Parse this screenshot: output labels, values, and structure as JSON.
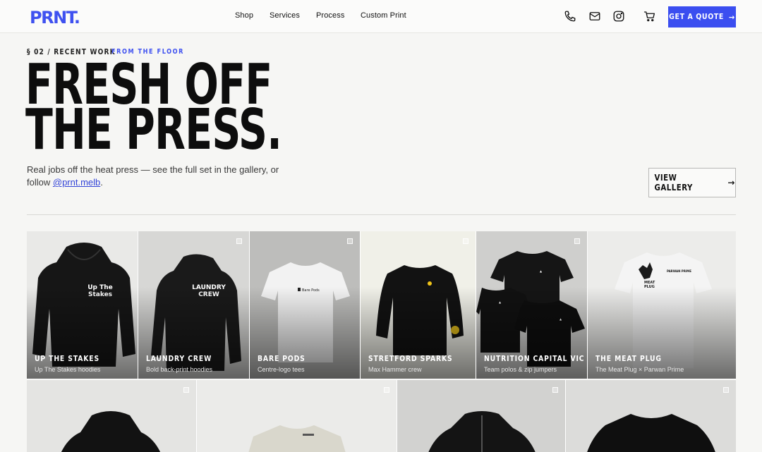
{
  "header": {
    "logo": "PRNT.",
    "nav": [
      "Shop",
      "Services",
      "Process",
      "Custom Print"
    ],
    "icons": [
      "phone-icon",
      "mail-icon",
      "instagram-icon",
      "cart-icon"
    ],
    "cta_label": "GET A QUOTE",
    "cta_color": "#3b4ef0"
  },
  "section": {
    "eyebrow": "§ 02 / RECENT WORK",
    "eyebrow_accent": "FROM THE FLOOR",
    "headline_line1": "FRESH OFF",
    "headline_line2": "THE PRESS.",
    "intro_text": "Real jobs off the heat press — see the full set in the gallery, or follow",
    "intro_link": "@prnt.melb",
    "intro_end": ".",
    "gallery_button": "VIEW GALLERY"
  },
  "works": [
    {
      "title": "UP THE STAKES",
      "subtitle": "Up The Stakes hoodies",
      "print": "Up The Stakes"
    },
    {
      "title": "LAUNDRY CREW",
      "subtitle": "Bold back-print hoodies",
      "print": "LAUNDRY CREW"
    },
    {
      "title": "BARE PODS",
      "subtitle": "Centre-logo tees",
      "print": "Bare Pods"
    },
    {
      "title": "STRETFORD SPARKS",
      "subtitle": "Max Hammer crew",
      "print": ""
    },
    {
      "title": "NUTRITION CAPITAL VIC",
      "subtitle": "Team polos & zip jumpers",
      "print": ""
    },
    {
      "title": "THE MEAT PLUG",
      "subtitle": "The Meat Plug × Parwan Prime",
      "print": "MEAT PLUG"
    }
  ],
  "accent_color": "#3f51f0"
}
